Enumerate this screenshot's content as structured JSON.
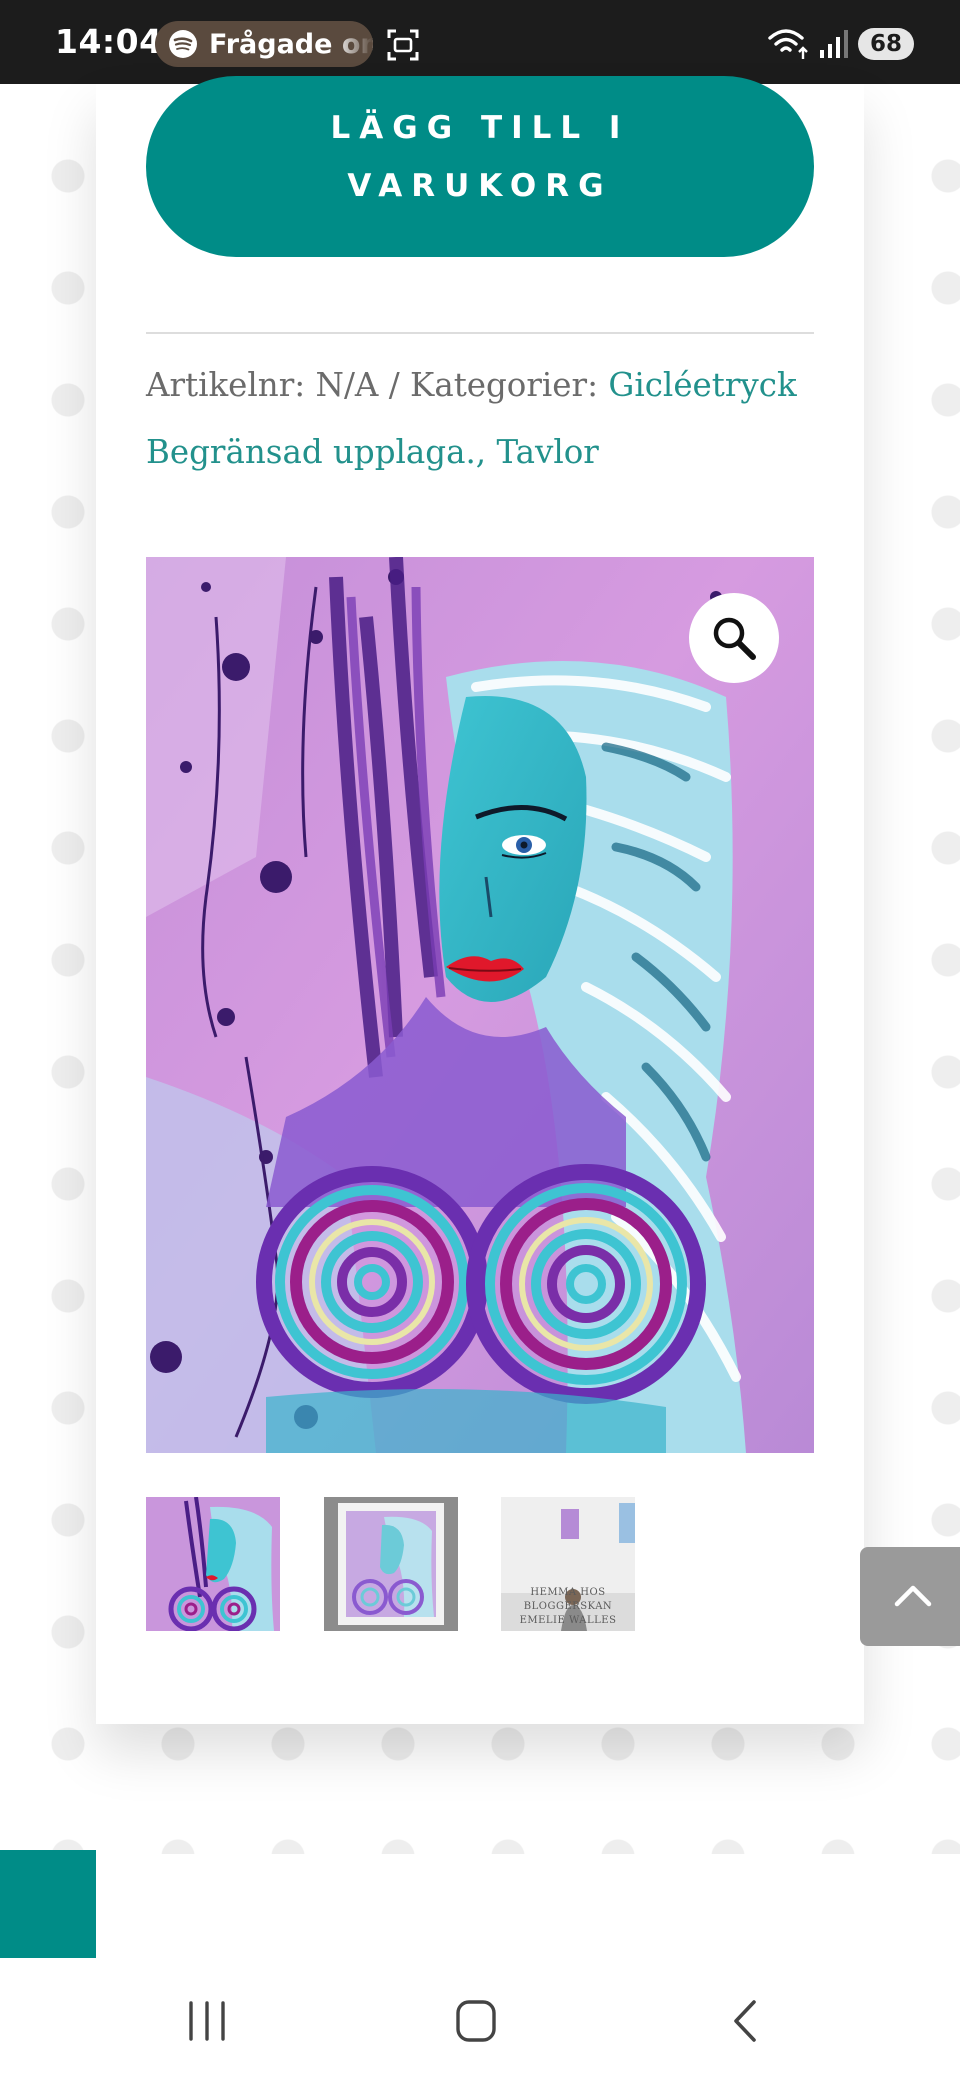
{
  "status_bar": {
    "time": "14:04",
    "media_text": "Frågade om",
    "battery": "68",
    "icons": [
      "spotify-icon",
      "screenshot-icon",
      "wifi-icon",
      "signal-icon",
      "battery-icon"
    ]
  },
  "product": {
    "add_to_cart_line1": "LÄGG TILL I",
    "add_to_cart_line2": "VARUKORG",
    "sku_label": "Artikelnr:",
    "sku_value": "N/A",
    "separator": "/",
    "categories_label": "Kategorier:",
    "categories": [
      "Gicléetryck Begränsad upplaga.",
      "Tavlor"
    ],
    "category_separator": ", ",
    "thumbnail_3_caption_lines": [
      "HEMMA HOS",
      "BLOGGERSKAN",
      "EMELIE WALLES"
    ]
  },
  "colors": {
    "accent": "#008c87",
    "link": "#22918c",
    "meta_text": "#6b6b6b",
    "back_to_top": "#9a9a9a"
  },
  "navigation": {
    "icons": [
      "recent-apps-icon",
      "home-icon",
      "back-icon"
    ]
  }
}
